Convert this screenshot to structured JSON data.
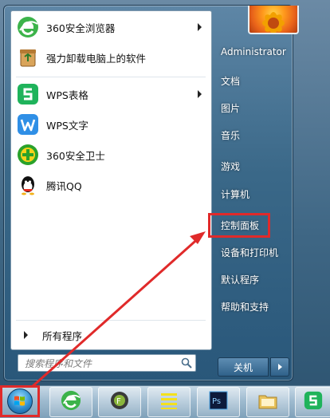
{
  "programs": [
    {
      "label": "360安全浏览器",
      "icon": "360-browser-icon",
      "has_submenu": true
    },
    {
      "label": "强力卸载电脑上的软件",
      "icon": "uninstall-icon",
      "has_submenu": false
    },
    {
      "label": "WPS表格",
      "icon": "wps-spreadsheet-icon",
      "has_submenu": true
    },
    {
      "label": "WPS文字",
      "icon": "wps-writer-icon",
      "has_submenu": false
    },
    {
      "label": "360安全卫士",
      "icon": "360-security-icon",
      "has_submenu": false
    },
    {
      "label": "腾讯QQ",
      "icon": "qq-icon",
      "has_submenu": false
    }
  ],
  "all_programs_label": "所有程序",
  "search": {
    "placeholder": "搜索程序和文件"
  },
  "right_items": [
    {
      "label": "Administrator"
    },
    {
      "label": "文档"
    },
    {
      "label": "图片"
    },
    {
      "label": "音乐"
    },
    {
      "label": "游戏"
    },
    {
      "label": "计算机"
    },
    {
      "label": "控制面板"
    },
    {
      "label": "设备和打印机"
    },
    {
      "label": "默认程序"
    },
    {
      "label": "帮助和支持"
    }
  ],
  "shutdown_label": "关机",
  "taskbar": {
    "items": [
      "360-browser-icon",
      "file-manager-icon",
      "notepad-icon",
      "photoshop-icon",
      "folder-icon",
      "wps-spreadsheet-icon"
    ]
  },
  "colors": {
    "highlight": "#e02a2a"
  }
}
